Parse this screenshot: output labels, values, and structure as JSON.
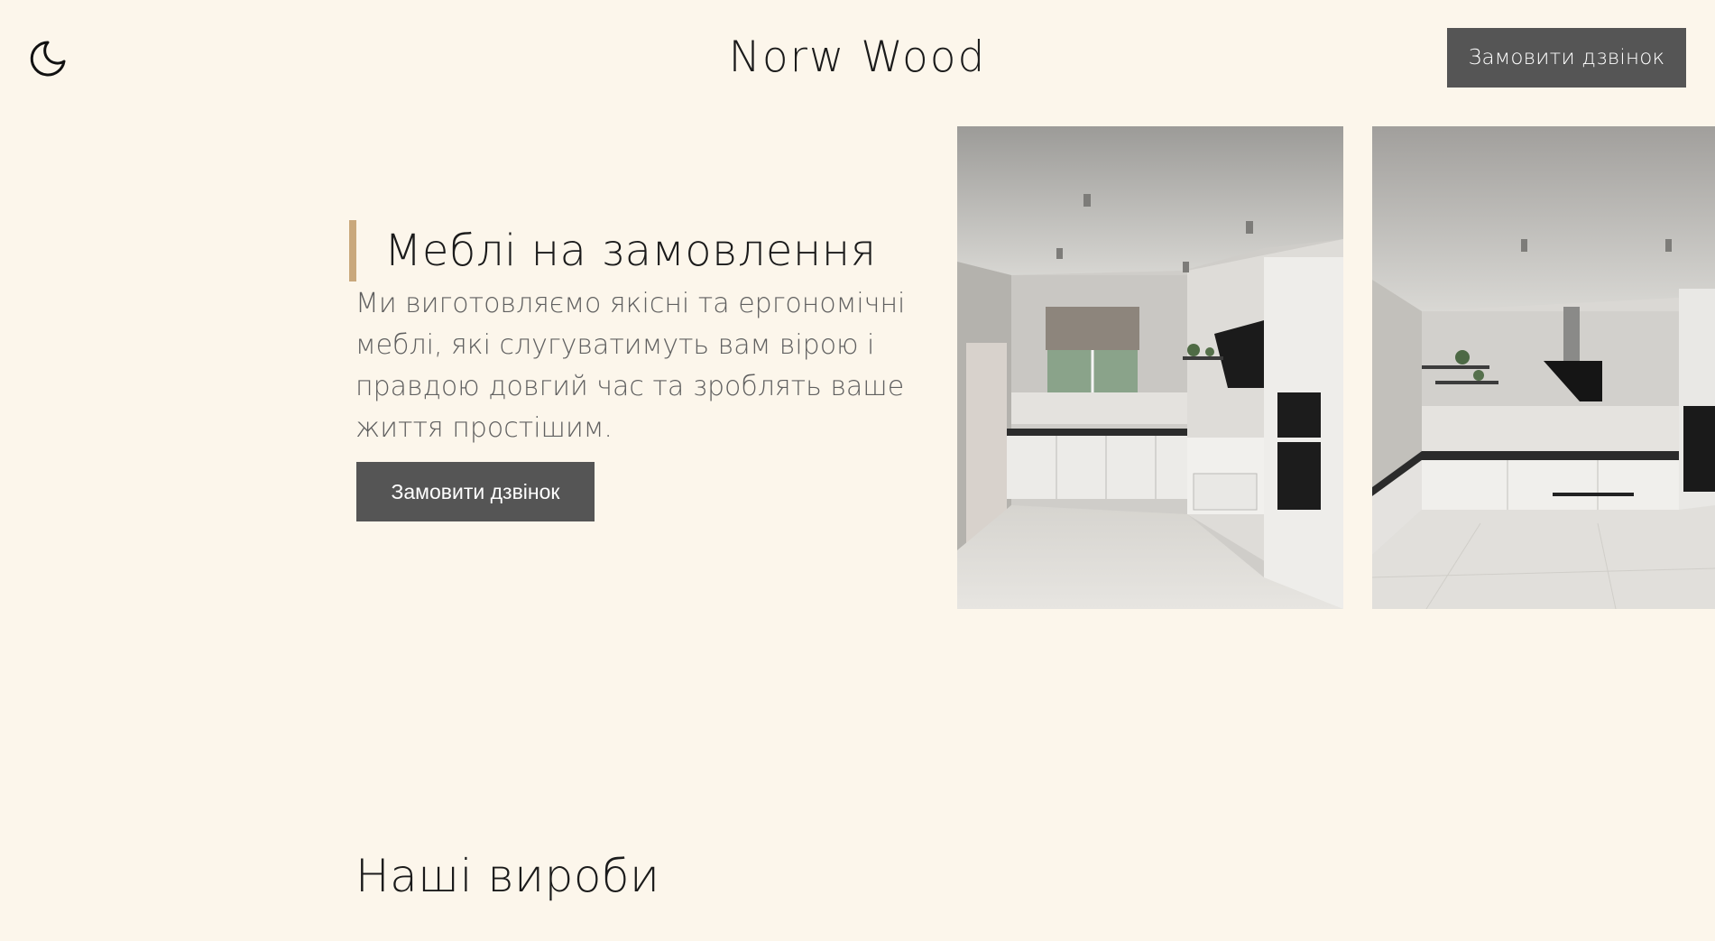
{
  "header": {
    "theme_toggle_icon": "moon-icon",
    "brand": "Norw Wood",
    "cta_label": "Замовити дзвінок"
  },
  "hero": {
    "title": "Меблі на замовлення",
    "description": "Ми виготовляємо якісні та ергономічні меблі, які слугуватимуть вам вірою і правдою довгий час та зроблять ваше життя простішим.",
    "cta_label": "Замовити дзвінок",
    "gallery": [
      {
        "name": "kitchen-photo-1"
      },
      {
        "name": "kitchen-photo-2"
      }
    ]
  },
  "products": {
    "title": "Наші вироби"
  },
  "colors": {
    "background": "#fcf6eb",
    "button": "#555555",
    "accent": "#c9a87c",
    "text": "#1b1b1b",
    "muted_text": "#606060"
  }
}
